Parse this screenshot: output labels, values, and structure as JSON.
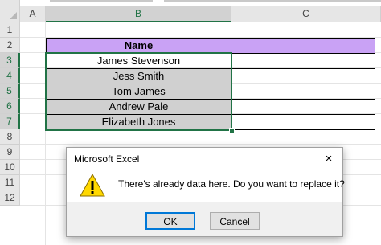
{
  "columns": {
    "a": "A",
    "b": "B",
    "c": "C"
  },
  "rows": [
    "1",
    "2",
    "3",
    "4",
    "5",
    "6",
    "7",
    "8",
    "9",
    "10",
    "11",
    "12"
  ],
  "table": {
    "header": "Name",
    "names": [
      "James Stevenson",
      "Jess Smith",
      "Tom James",
      "Andrew Pale",
      "Elizabeth Jones"
    ]
  },
  "dialog": {
    "title": "Microsoft Excel",
    "close_icon": "×",
    "message": "There's already data here. Do you want to replace it?",
    "ok_label": "OK",
    "cancel_label": "Cancel",
    "icon": "warning-icon"
  },
  "colors": {
    "header_fill": "#c9a2f5",
    "selected_fill": "#d0d0d0",
    "selection_border": "#217346",
    "warning": "#ffd800"
  }
}
